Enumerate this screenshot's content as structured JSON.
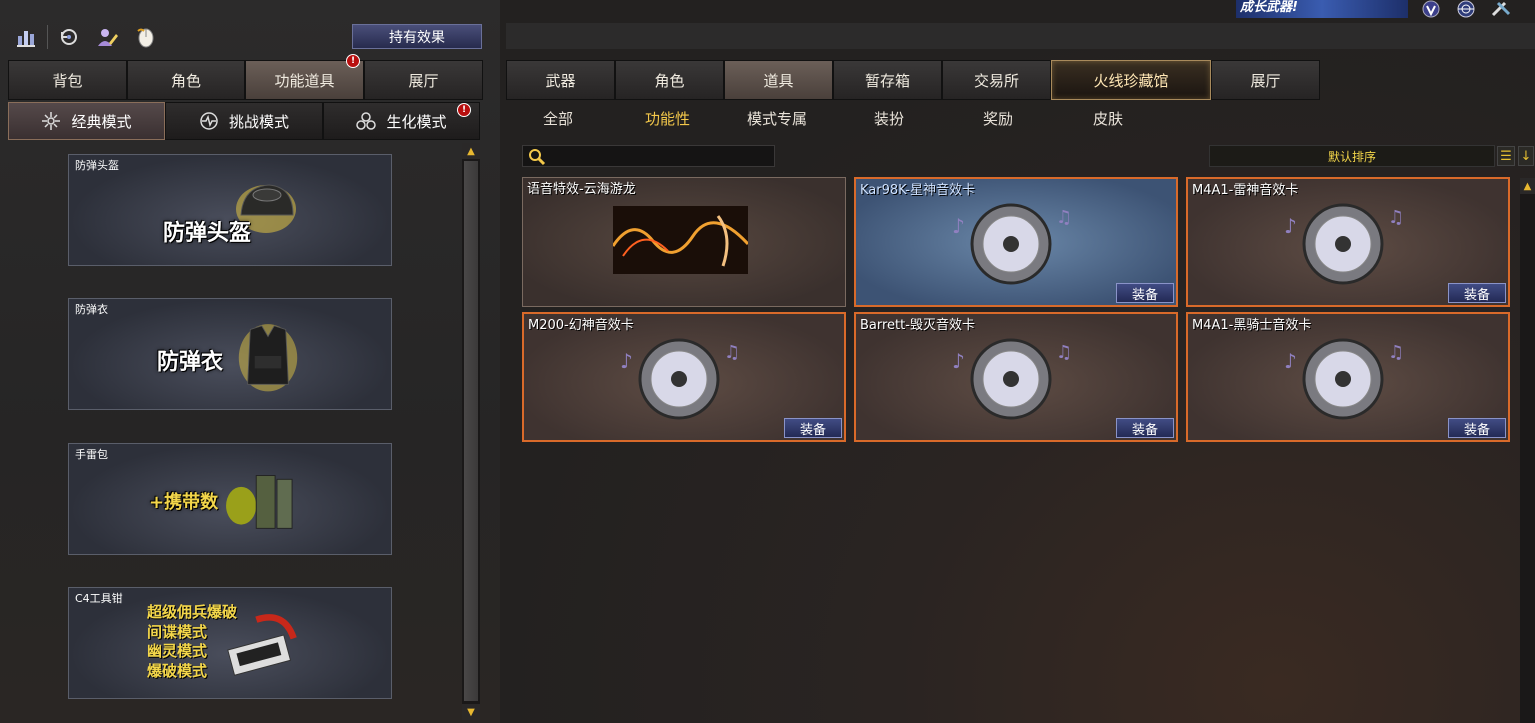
{
  "toolbar": {
    "effect_button": "持有效果",
    "icons": [
      "ranking-icon",
      "refresh-icon",
      "character-edit-icon",
      "mouse-icon"
    ]
  },
  "banner": {
    "text": "成长武器!"
  },
  "left_tabs": [
    {
      "label": "背包",
      "active": false
    },
    {
      "label": "角色",
      "active": false
    },
    {
      "label": "功能道具",
      "active": true
    },
    {
      "label": "展厅",
      "active": false
    }
  ],
  "modes": [
    {
      "label": "经典模式",
      "icon": "crosshair-icon",
      "active": true
    },
    {
      "label": "挑战模式",
      "icon": "pulse-icon",
      "active": false
    },
    {
      "label": "生化模式",
      "icon": "biohazard-icon",
      "active": false
    }
  ],
  "left_items": [
    {
      "title": "防弹头盔",
      "big": "防弹头盔"
    },
    {
      "title": "防弹衣",
      "big": "防弹衣"
    },
    {
      "title": "手雷包",
      "big": "+携带数"
    },
    {
      "title": "C4工具钳",
      "lines": [
        "超级佣兵爆破",
        "间谍模式",
        "幽灵模式",
        "爆破模式"
      ]
    }
  ],
  "right_tabs": [
    {
      "label": "武器",
      "active": false
    },
    {
      "label": "角色",
      "active": false
    },
    {
      "label": "道具",
      "active": true
    },
    {
      "label": "暂存箱",
      "active": false
    },
    {
      "label": "交易所",
      "active": false
    },
    {
      "label": "火线珍藏馆",
      "special": true
    },
    {
      "label": "展厅",
      "active": false
    }
  ],
  "sub_tabs": [
    {
      "label": "全部",
      "active": false
    },
    {
      "label": "功能性",
      "active": true
    },
    {
      "label": "模式专属",
      "active": false
    },
    {
      "label": "装扮",
      "active": false
    },
    {
      "label": "奖励",
      "active": false
    },
    {
      "label": "皮肤",
      "active": false
    }
  ],
  "search": {
    "placeholder": ""
  },
  "sort": {
    "label": "默认排序"
  },
  "items": [
    {
      "name": "语音特效-云海游龙",
      "equip": "",
      "style": "plain"
    },
    {
      "name": "Kar98K-星神音效卡",
      "equip": "装备",
      "style": "sel"
    },
    {
      "name": "M4A1-雷神音效卡",
      "equip": "装备",
      "style": ""
    },
    {
      "name": "M200-幻神音效卡",
      "equip": "装备",
      "style": ""
    },
    {
      "name": "Barrett-毁灭音效卡",
      "equip": "装备",
      "style": ""
    },
    {
      "name": "M4A1-黑骑士音效卡",
      "equip": "装备",
      "style": ""
    }
  ],
  "colors": {
    "accent": "#f3c84a",
    "equip_button": "#2d3568",
    "card_border": "#d96a2a"
  }
}
